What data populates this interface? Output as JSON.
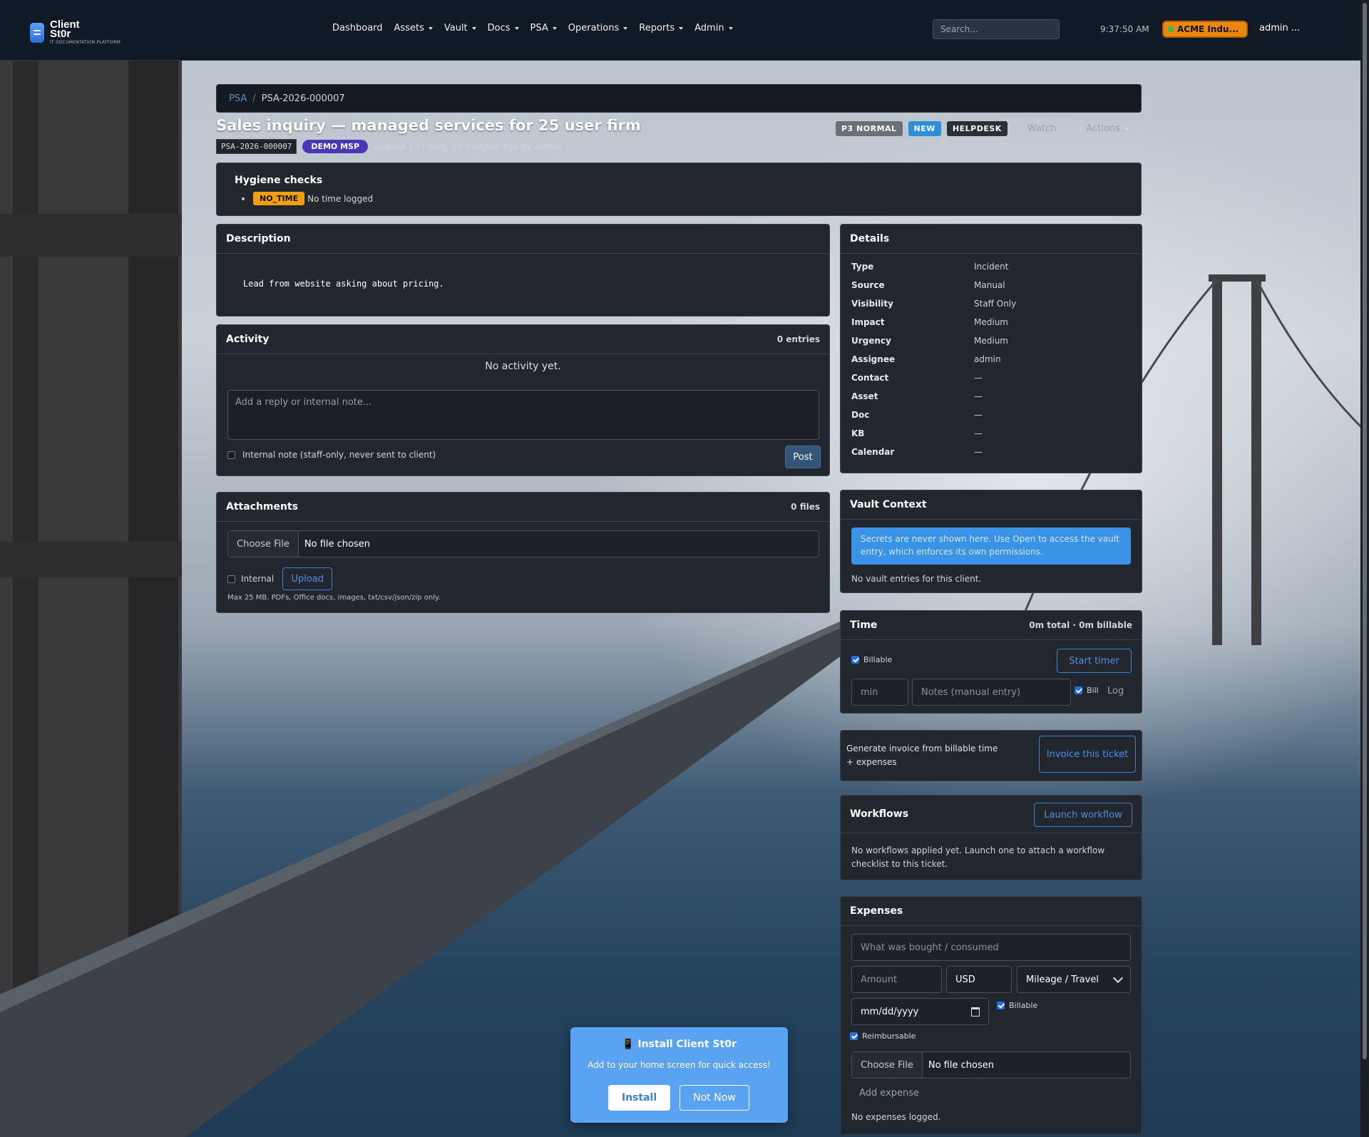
{
  "brand": {
    "name_line1": "Client",
    "name_line2": "St0r",
    "tagline": "IT DOCUMENTATION PLATFORM"
  },
  "nav": {
    "items": [
      {
        "label": "Dashboard",
        "dropdown": false
      },
      {
        "label": "Assets",
        "dropdown": true
      },
      {
        "label": "Vault",
        "dropdown": true
      },
      {
        "label": "Docs",
        "dropdown": true
      },
      {
        "label": "PSA",
        "dropdown": true
      },
      {
        "label": "Operations",
        "dropdown": true
      },
      {
        "label": "Reports",
        "dropdown": true
      },
      {
        "label": "Admin",
        "dropdown": true
      }
    ],
    "search_placeholder": "Search...",
    "clock": "9:37:50 AM",
    "org": "ACME Indu...",
    "user": "admin ..."
  },
  "breadcrumb": {
    "root": "PSA",
    "separator": "/",
    "current": "PSA-2026-000007"
  },
  "ticket": {
    "title": "Sales inquiry — managed services for 25 user firm",
    "id": "PSA-2026-000007",
    "client": "DEMO MSP",
    "opened": "opened 14 hours, 56 minutes ago by admin",
    "priority": "P3 NORMAL",
    "status": "NEW",
    "queue": "HELPDESK",
    "watch_label": "Watch",
    "actions_label": "Actions"
  },
  "hygiene": {
    "title": "Hygiene checks",
    "flag": "NO_TIME",
    "flag_text": "No time logged"
  },
  "description": {
    "title": "Description",
    "body": "Lead from website asking about pricing."
  },
  "activity": {
    "title": "Activity",
    "count": "0 entries",
    "empty": "No activity yet.",
    "reply_placeholder": "Add a reply or internal note...",
    "internal_label": "Internal note (staff-only, never sent to client)",
    "post_label": "Post"
  },
  "attachments": {
    "title": "Attachments",
    "count": "0 files",
    "choose_label": "Choose File",
    "no_file": "No file chosen",
    "internal_label": "Internal",
    "upload_label": "Upload",
    "hint": "Max 25 MB. PDFs, Office docs, images, txt/csv/json/zip only."
  },
  "details": {
    "title": "Details",
    "rows": [
      {
        "k": "Type",
        "v": "Incident"
      },
      {
        "k": "Source",
        "v": "Manual"
      },
      {
        "k": "Visibility",
        "v": "Staff Only"
      },
      {
        "k": "Impact",
        "v": "Medium"
      },
      {
        "k": "Urgency",
        "v": "Medium"
      },
      {
        "k": "Assignee",
        "v": "admin"
      },
      {
        "k": "Contact",
        "v": "—"
      },
      {
        "k": "Asset",
        "v": "—"
      },
      {
        "k": "Doc",
        "v": "—"
      },
      {
        "k": "KB",
        "v": "—"
      },
      {
        "k": "Calendar",
        "v": "—"
      }
    ]
  },
  "vault": {
    "title": "Vault Context",
    "note": "Secrets are never shown here. Use Open to access the vault entry, which enforces its own permissions.",
    "empty": "No vault entries for this client."
  },
  "time": {
    "title": "Time",
    "summary": "0m total · 0m billable",
    "billable_label": "Billable",
    "start_label": "Start timer",
    "min_placeholder": "min",
    "notes_placeholder": "Notes (manual entry)",
    "bill_label": "Bill",
    "log_label": "Log"
  },
  "invoice": {
    "text": "Generate invoice from billable time + expenses",
    "button": "Invoice this ticket"
  },
  "workflows": {
    "title": "Workflows",
    "launch_label": "Launch workflow",
    "empty": "No workflows applied yet. Launch one to attach a workflow checklist to this ticket."
  },
  "expenses": {
    "title": "Expenses",
    "what_placeholder": "What was bought / consumed",
    "amount_placeholder": "Amount",
    "currency": "USD",
    "category": "Mileage / Travel",
    "date_placeholder": "mm/dd/yyyy",
    "billable_label": "Billable",
    "reimbursable_label": "Reimbursable",
    "choose_label": "Choose File",
    "no_file": "No file chosen",
    "add_label": "Add expense",
    "empty": "No expenses logged."
  },
  "install_prompt": {
    "title": "📱 Install Client St0r",
    "subtitle": "Add to your home screen for quick access!",
    "install_label": "Install",
    "dismiss_label": "Not Now"
  },
  "colors": {
    "accent": "#3b7fd8",
    "nav_bg": "#101a26",
    "panel_bg": "#22272e",
    "warning": "#f59e0b",
    "org": "#e8880f"
  }
}
